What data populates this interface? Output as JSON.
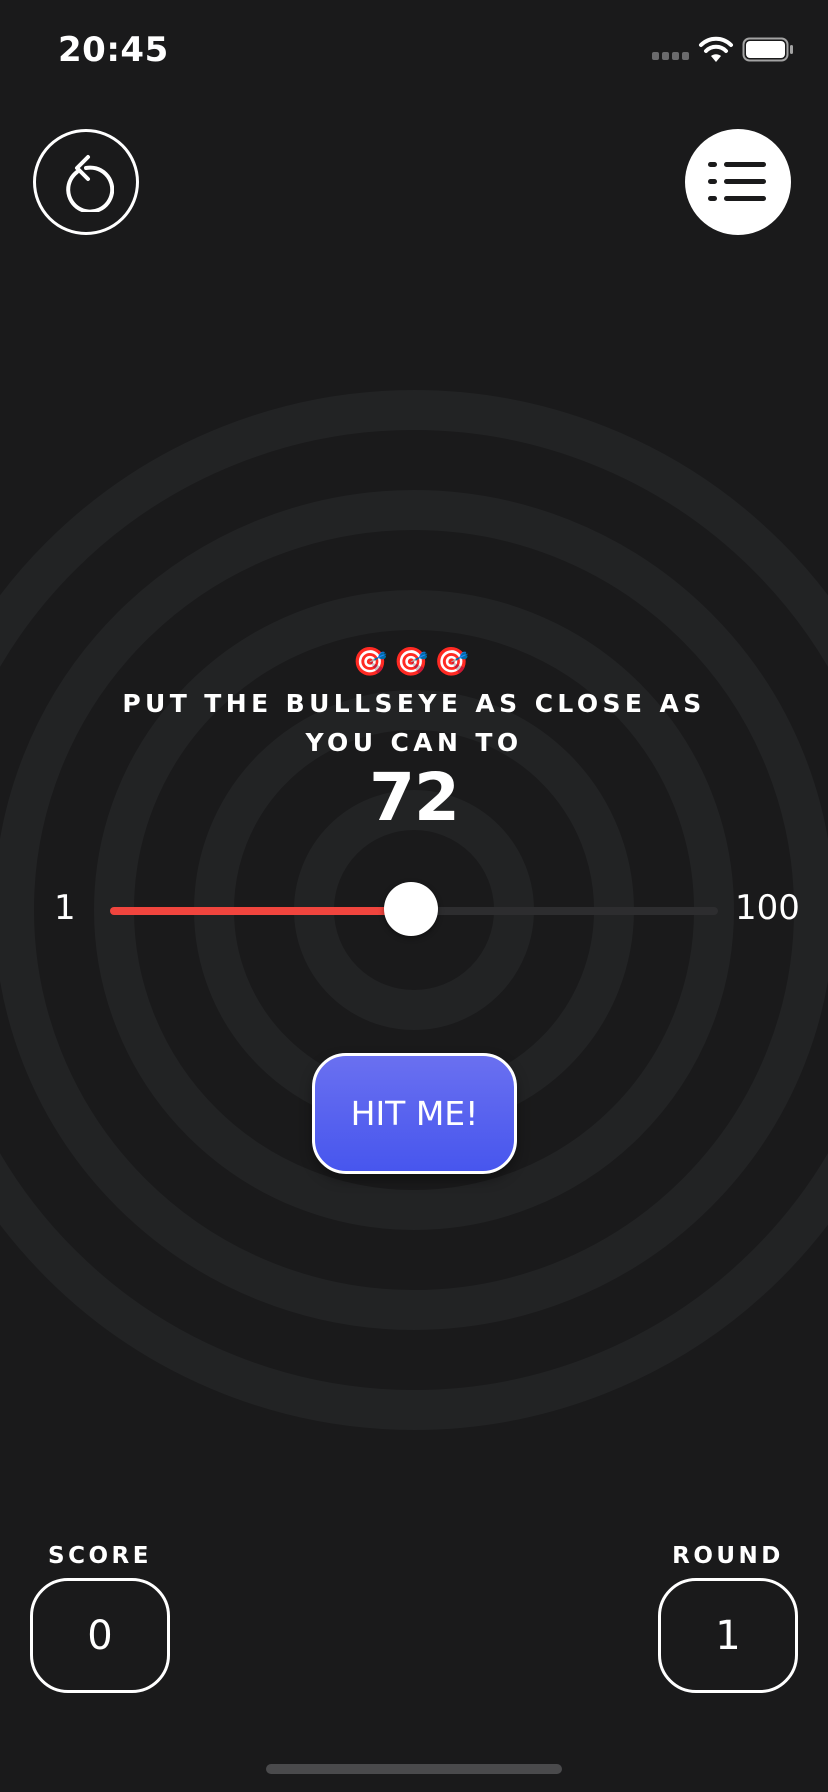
{
  "status_bar": {
    "time": "20:45"
  },
  "colors": {
    "background": "#1a1a1b",
    "ring": "#232425",
    "slider_fill": "#f0453e",
    "slider_track": "#2d2d2f",
    "hit_button": "#4f5df0",
    "text": "#ffffff"
  },
  "toolbar": {
    "restart_icon": "restart-icon",
    "leaderboard_icon": "list-icon"
  },
  "game": {
    "darts": "🎯🎯🎯",
    "instruction": "PUT THE BULLSEYE AS CLOSE AS YOU CAN TO",
    "target": "72"
  },
  "slider": {
    "min_label": "1",
    "max_label": "100",
    "min": 1,
    "max": 100,
    "value": 50
  },
  "hit_button": {
    "label": "HIT ME!"
  },
  "stats": {
    "score_label": "SCORE",
    "score_value": "0",
    "round_label": "ROUND",
    "round_value": "1"
  }
}
